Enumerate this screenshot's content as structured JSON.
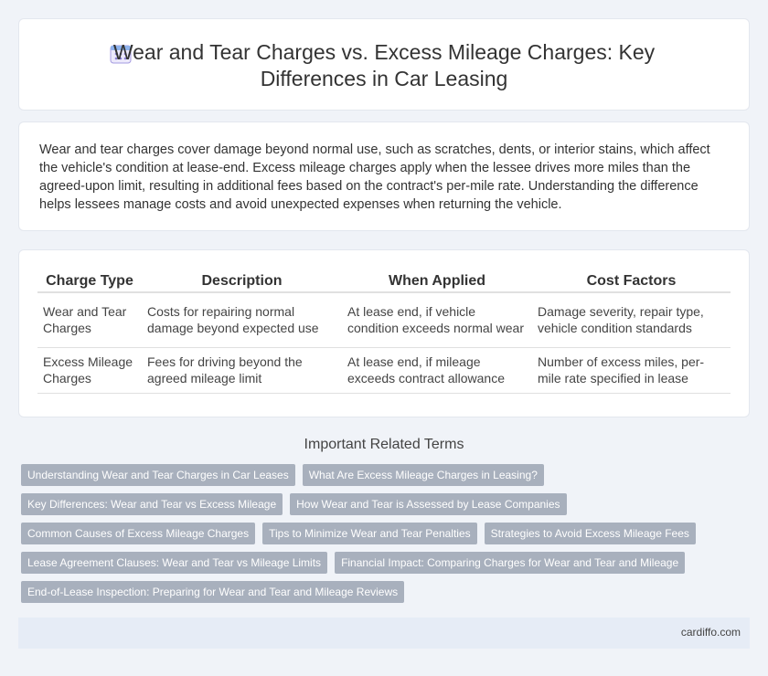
{
  "header": {
    "icon": "calendar-icon",
    "title_line1": "Wear and Tear Charges vs. Excess Mileage Charges: Key",
    "title_line2": "Differences in Car Leasing"
  },
  "intro": {
    "text": "Wear and tear charges cover damage beyond normal use, such as scratches, dents, or interior stains, which affect the vehicle's condition at lease-end. Excess mileage charges apply when the lessee drives more miles than the agreed-upon limit, resulting in additional fees based on the contract's per-mile rate. Understanding the difference helps lessees manage costs and avoid unexpected expenses when returning the vehicle."
  },
  "table": {
    "headers": [
      "Charge Type",
      "Description",
      "When Applied",
      "Cost Factors"
    ],
    "rows": [
      [
        "Wear and Tear Charges",
        "Costs for repairing normal damage beyond expected use",
        "At lease end, if vehicle condition exceeds normal wear",
        "Damage severity, repair type, vehicle condition standards"
      ],
      [
        "Excess Mileage Charges",
        "Fees for driving beyond the agreed mileage limit",
        "At lease end, if mileage exceeds contract allowance",
        "Number of excess miles, per-mile rate specified in lease"
      ]
    ]
  },
  "related": {
    "title": "Important Related Terms",
    "tags": [
      "Understanding Wear and Tear Charges in Car Leases",
      "What Are Excess Mileage Charges in Leasing?",
      "Key Differences: Wear and Tear vs Excess Mileage",
      "How Wear and Tear is Assessed by Lease Companies",
      "Common Causes of Excess Mileage Charges",
      "Tips to Minimize Wear and Tear Penalties",
      "Strategies to Avoid Excess Mileage Fees",
      "Lease Agreement Clauses: Wear and Tear vs Mileage Limits",
      "Financial Impact: Comparing Charges for Wear and Tear and Mileage",
      "End-of-Lease Inspection: Preparing for Wear and Tear and Mileage Reviews"
    ]
  },
  "footer": {
    "site": "cardiffo.com"
  },
  "colors": {
    "tag_bg": "#a8b0bd",
    "page_bg": "#f0f3f8",
    "footer_bg": "#e6ecf6",
    "icon_accent": "#8a7fd6"
  }
}
